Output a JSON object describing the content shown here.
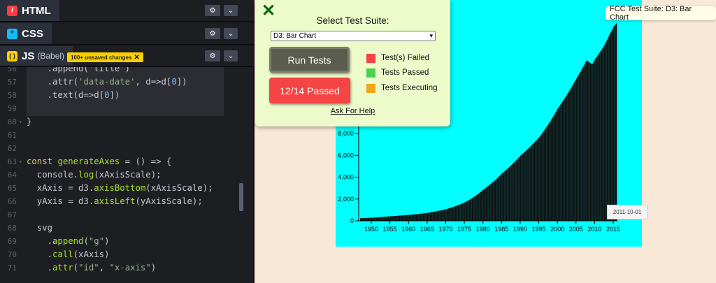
{
  "editor": {
    "html_tab": {
      "icon": "html-icon",
      "label": "HTML"
    },
    "css_tab": {
      "icon": "css-icon",
      "label": "CSS"
    },
    "js_tab": {
      "icon": "js-icon",
      "label": "JS",
      "sublabel": "(Babel)",
      "unsaved_badge": "100+ unsaved changes"
    },
    "code_lines": [
      {
        "n": "56",
        "segments": [
          [
            "pl",
            "    .append('title')"
          ]
        ],
        "clip": true
      },
      {
        "n": "57",
        "segments": [
          [
            "pl",
            "    .attr("
          ],
          [
            "str",
            "'data-date'"
          ],
          [
            "pl",
            ", d=>d["
          ],
          [
            "num",
            "0"
          ],
          [
            "pl",
            "])"
          ]
        ]
      },
      {
        "n": "58",
        "segments": [
          [
            "pl",
            "    .text(d=>d["
          ],
          [
            "num",
            "0"
          ],
          [
            "pl",
            "])"
          ]
        ]
      },
      {
        "n": "59",
        "segments": []
      },
      {
        "n": "60",
        "segments": [
          [
            "pl",
            "}"
          ]
        ],
        "fold": true
      },
      {
        "n": "61",
        "segments": []
      },
      {
        "n": "62",
        "segments": []
      },
      {
        "n": "63",
        "segments": [
          [
            "kw",
            "const"
          ],
          [
            "pl",
            " "
          ],
          [
            "fn",
            "generateAxes"
          ],
          [
            "pl",
            " = () => {"
          ]
        ],
        "fold": true
      },
      {
        "n": "64",
        "segments": [
          [
            "pl",
            "  console."
          ],
          [
            "fn",
            "log"
          ],
          [
            "pl",
            "(xAxisScale);"
          ]
        ]
      },
      {
        "n": "65",
        "segments": [
          [
            "pl",
            "  xAxis = d3."
          ],
          [
            "fn",
            "axisBottom"
          ],
          [
            "pl",
            "(xAxisScale);"
          ]
        ]
      },
      {
        "n": "66",
        "segments": [
          [
            "pl",
            "  yAxis = d3."
          ],
          [
            "fn",
            "axisLeft"
          ],
          [
            "pl",
            "(yAxisScale);"
          ]
        ]
      },
      {
        "n": "67",
        "segments": []
      },
      {
        "n": "68",
        "segments": [
          [
            "pl",
            "  svg"
          ]
        ]
      },
      {
        "n": "69",
        "segments": [
          [
            "pl",
            "    ."
          ],
          [
            "fn",
            "append"
          ],
          [
            "pl",
            "("
          ],
          [
            "str",
            "\"g\""
          ],
          [
            "pl",
            ")"
          ]
        ]
      },
      {
        "n": "70",
        "segments": [
          [
            "pl",
            "    ."
          ],
          [
            "fn",
            "call"
          ],
          [
            "pl",
            "(xAxis)"
          ]
        ]
      },
      {
        "n": "71",
        "segments": [
          [
            "pl",
            "    ."
          ],
          [
            "fn",
            "attr"
          ],
          [
            "pl",
            "("
          ],
          [
            "str",
            "\"id\""
          ],
          [
            "pl",
            ", "
          ],
          [
            "str",
            "\"x-axis\""
          ],
          [
            "pl",
            ")"
          ]
        ]
      }
    ]
  },
  "fcc": {
    "title": "Select Test Suite:",
    "selected_suite": "D3: Bar Chart",
    "run_button": "Run Tests",
    "result_button": "12/14 Passed",
    "legend": [
      {
        "label": "Test(s) Failed",
        "color": "#f44444"
      },
      {
        "label": "Tests Passed",
        "color": "#4cd14c"
      },
      {
        "label": "Tests Executing",
        "color": "#f0a71c"
      }
    ],
    "help_link": "Ask For Help",
    "badge": "FCC Test Suite: D3: Bar Chart"
  },
  "tooltip": {
    "text": "2011-10-01"
  },
  "chart_data": {
    "type": "bar",
    "title": "",
    "xlabel": "",
    "ylabel": "",
    "x_ticks": [
      "1950",
      "1955",
      "1960",
      "1965",
      "1970",
      "1975",
      "1980",
      "1985",
      "1990",
      "1995",
      "2000",
      "2005",
      "2010",
      "2015"
    ],
    "y_ticks": [
      "0",
      "2,000",
      "4,000",
      "6,000",
      "8,000"
    ],
    "xlim": [
      1947,
      2015.75
    ],
    "ylim": [
      0,
      18000
    ],
    "bar_color": "#111111",
    "series": [
      {
        "x": [
          1947,
          1950,
          1955,
          1960,
          1965,
          1970,
          1975,
          1980,
          1985,
          1990,
          1995,
          2000,
          2005,
          2007.75,
          2009.25,
          2010,
          2012,
          2015,
          2015.75
        ],
        "values": [
          243,
          280,
          420,
          540,
          730,
          1070,
          1690,
          2860,
          4350,
          5980,
          7660,
          10290,
          13040,
          14700,
          14360,
          14800,
          15800,
          17800,
          18100
        ]
      }
    ]
  }
}
